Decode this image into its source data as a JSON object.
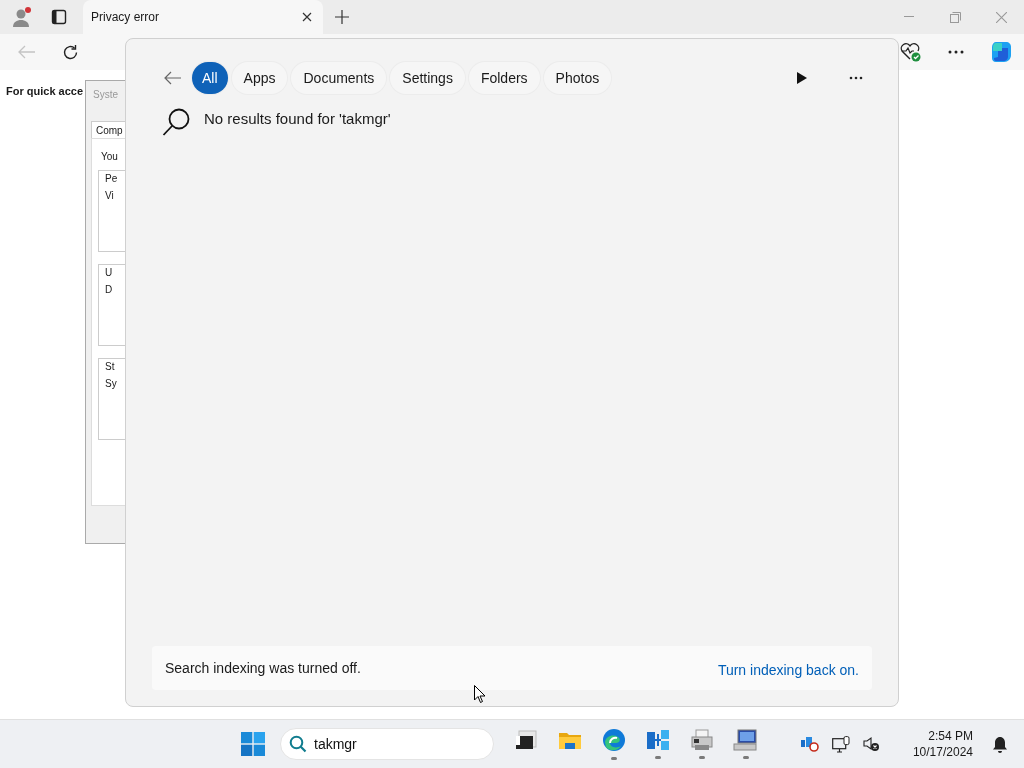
{
  "browser": {
    "tab": {
      "title": "Privacy error"
    },
    "back_button": {
      "disabled": true
    },
    "page_text": "For quick acce"
  },
  "background_dialog": {
    "title": "Syste",
    "tab": "Comp",
    "intro": "You",
    "groups": [
      {
        "label": "Pe",
        "value": "Vi"
      },
      {
        "label": "U",
        "value": "D"
      },
      {
        "label": "St",
        "value": "Sy"
      }
    ]
  },
  "search_panel": {
    "filters": [
      {
        "label": "All",
        "selected": true
      },
      {
        "label": "Apps",
        "selected": false
      },
      {
        "label": "Documents",
        "selected": false
      },
      {
        "label": "Settings",
        "selected": false
      },
      {
        "label": "Folders",
        "selected": false
      },
      {
        "label": "Photos",
        "selected": false
      }
    ],
    "message": "No results found for 'takmgr'",
    "footer": {
      "text": "Search indexing was turned off.",
      "link": "Turn indexing back on."
    }
  },
  "taskbar": {
    "search": {
      "value": "takmgr"
    },
    "apps": [
      {
        "kind": "taskview",
        "running": false
      },
      {
        "kind": "folder",
        "running": false
      },
      {
        "kind": "edge",
        "running": true
      },
      {
        "kind": "network",
        "running": true
      },
      {
        "kind": "printer",
        "running": true
      },
      {
        "kind": "computer",
        "running": true
      }
    ],
    "clock": {
      "time": "2:54 PM",
      "date": "10/17/2024"
    }
  }
}
